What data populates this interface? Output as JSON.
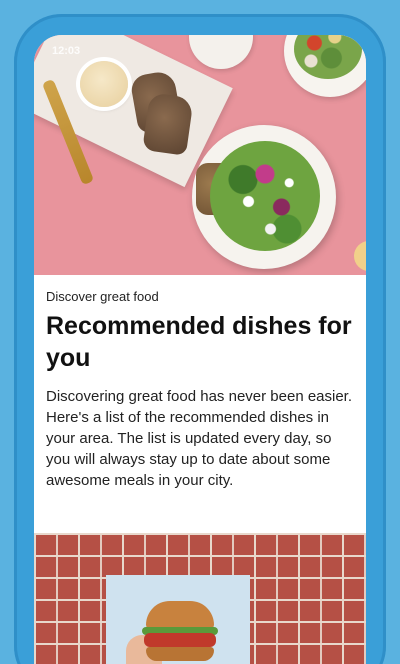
{
  "status_bar": {
    "time": "12:03"
  },
  "article": {
    "eyebrow": "Discover great food",
    "title": "Recommended dishes for you",
    "body": "Discovering great food has never been easier. Here's a list of the recommended dishes in your area. The list is updated every day, so you will always stay up to date about some awesome meals in your city."
  },
  "colors": {
    "background": "#5ab2e0",
    "phone_frame": "#3a9fd8",
    "hero_bg": "#e8949c",
    "brick": "#b55045"
  }
}
